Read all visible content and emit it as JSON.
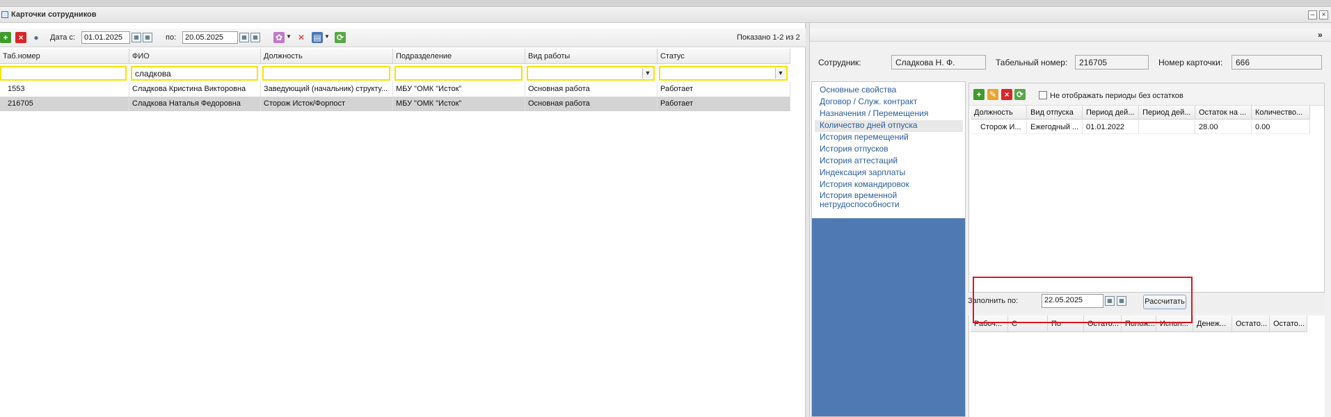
{
  "window": {
    "title": "Карточки сотрудников",
    "minimize_glyph": "–",
    "close_glyph": "×"
  },
  "toolbar": {
    "add_icon": "plus-icon",
    "delete_icon": "delete-icon",
    "user_icon": "person-icon",
    "date_from_label": "Дата с:",
    "date_from_value": "01.01.2025",
    "date_to_label": "по:",
    "date_to_value": "20.05.2025",
    "shown_label": "Показано 1-2 из 2"
  },
  "grid": {
    "columns": [
      {
        "key": "tab",
        "label": "Таб.номер"
      },
      {
        "key": "fio",
        "label": "ФИО"
      },
      {
        "key": "pos",
        "label": "Должность"
      },
      {
        "key": "dept",
        "label": "Подразделение"
      },
      {
        "key": "work",
        "label": "Вид работы"
      },
      {
        "key": "status",
        "label": "Статус"
      }
    ],
    "filters": {
      "tab": "",
      "fio": "сладкова",
      "pos": "",
      "dept": "",
      "work": "",
      "status": ""
    },
    "rows": [
      {
        "tab": "1553",
        "fio": "Сладкова Кристина Викторовна",
        "pos": "Заведующий (начальник) структу...",
        "dept": "МБУ \"ОМК \"Исток\"",
        "work": "Основная работа",
        "status": "Работает"
      },
      {
        "tab": "216705",
        "fio": "Сладкова Наталья Федоровна",
        "pos": "Сторож Исток/Форпост",
        "dept": "МБУ \"ОМК \"Исток\"",
        "work": "Основная работа",
        "status": "Работает"
      }
    ]
  },
  "detail": {
    "expand_glyph": "»",
    "employee_label": "Сотрудник:",
    "employee_value": "Сладкова Н. Ф.",
    "tabnum_label": "Табельный номер:",
    "tabnum_value": "216705",
    "card_label": "Номер карточки:",
    "card_value": "666"
  },
  "nav": {
    "items": [
      "Основные свойства",
      "Договор / Служ. контракт",
      "Назначения / Перемещения",
      "Количество дней отпуска",
      "История перемещений",
      "История отпусков",
      "История аттестаций",
      "Индексация зарплаты",
      "История командировок",
      "История временной нетрудоспособности"
    ],
    "selected_index": 3
  },
  "vacation": {
    "checkbox_label": "Не отображать периоды без остатков",
    "columns": [
      "Должность",
      "Вид отпуска",
      "Период дей...",
      "Период дей...",
      "Остаток на ...",
      "Количество..."
    ],
    "rows": [
      [
        "Сторож И...",
        "Ежегодный ...",
        "01.01.2022",
        "",
        "28.00",
        "0.00"
      ]
    ]
  },
  "fill": {
    "label": "Заполнить по:",
    "date_value": "22.05.2025",
    "calc_button": "Рассчитать"
  },
  "lower": {
    "columns": [
      "Рабоч...",
      "С",
      "По",
      "Остато...",
      "Полож...",
      "Испол...",
      "Денеж...",
      "Остато...",
      "Остато..."
    ]
  },
  "colors": {
    "nav_blue": "#4e79b3",
    "link_blue": "#2a5d9a",
    "filter_yellow": "#f5e300",
    "highlight_red": "#e0141e",
    "selected_row": "#d3d3d3"
  }
}
